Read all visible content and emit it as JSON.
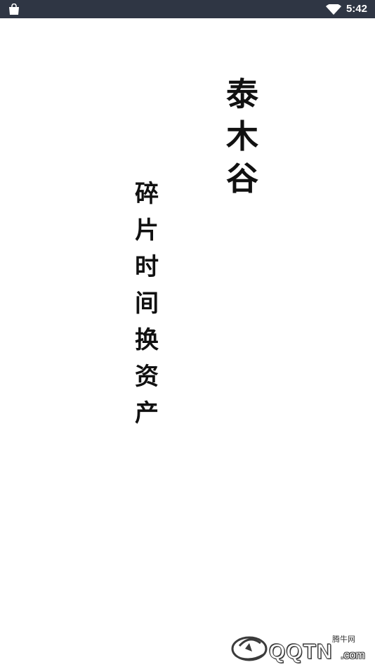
{
  "status_bar": {
    "time": "5:42",
    "left_icon": "shopping-bag-icon",
    "right_icons": [
      "wifi-icon"
    ],
    "background": "#2f3644"
  },
  "splash": {
    "brand_chars": [
      "泰",
      "木",
      "谷"
    ],
    "slogan_chars": [
      "碎",
      "片",
      "时",
      "间",
      "换",
      "资",
      "产"
    ]
  },
  "watermark": {
    "brand": "QQTN",
    "suffix": ".com",
    "cn_name": "腾牛网"
  }
}
